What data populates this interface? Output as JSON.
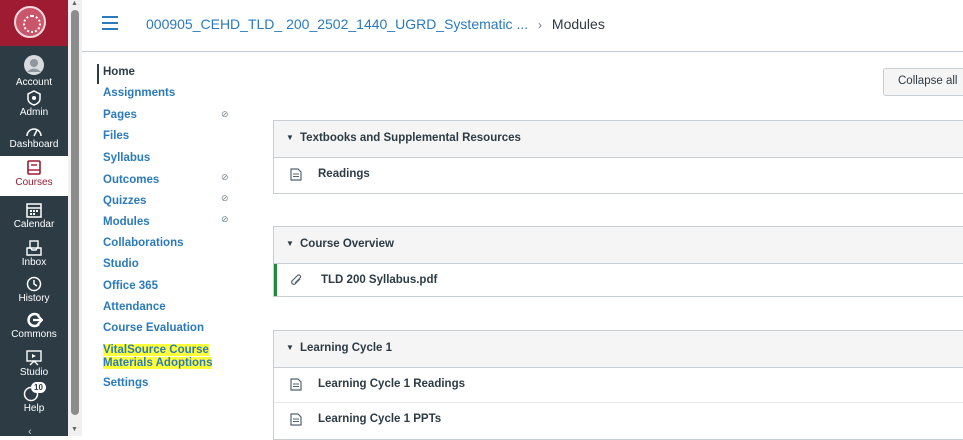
{
  "global_nav": {
    "items": [
      {
        "label": "Account",
        "icon": "account-icon"
      },
      {
        "label": "Admin",
        "icon": "admin-icon"
      },
      {
        "label": "Dashboard",
        "icon": "dashboard-icon"
      },
      {
        "label": "Courses",
        "icon": "courses-icon",
        "active": true
      },
      {
        "label": "Calendar",
        "icon": "calendar-icon"
      },
      {
        "label": "Inbox",
        "icon": "inbox-icon"
      },
      {
        "label": "History",
        "icon": "history-icon"
      },
      {
        "label": "Commons",
        "icon": "commons-icon"
      },
      {
        "label": "Studio",
        "icon": "studio-icon"
      },
      {
        "label": "Help",
        "icon": "help-icon",
        "badge": "10"
      }
    ],
    "brand_color": "#9e1b32",
    "nav_color": "#2d3b45"
  },
  "header": {
    "course_link": "000905_CEHD_TLD_ 200_2502_1440_UGRD_Systematic ...",
    "separator": "›",
    "current_page": "Modules"
  },
  "course_nav": {
    "items": [
      {
        "label": "Home",
        "current": true
      },
      {
        "label": "Assignments"
      },
      {
        "label": "Pages",
        "hidden": true
      },
      {
        "label": "Files"
      },
      {
        "label": "Syllabus"
      },
      {
        "label": "Outcomes",
        "hidden": true
      },
      {
        "label": "Quizzes",
        "hidden": true
      },
      {
        "label": "Modules",
        "hidden": true
      },
      {
        "label": "Collaborations"
      },
      {
        "label": "Studio"
      },
      {
        "label": "Office 365"
      },
      {
        "label": "Attendance"
      },
      {
        "label": "Course Evaluation"
      },
      {
        "label_line1": "VitalSource Course",
        "label_line2": "Materials Adoptions",
        "highlighted": true
      },
      {
        "label": "Settings"
      }
    ],
    "hidden_icon": "eye-slash-icon"
  },
  "toolbar": {
    "collapse_label": "Collapse all"
  },
  "modules": [
    {
      "title": "Textbooks and Supplemental Resources",
      "items": [
        {
          "label": "Readings",
          "icon": "page-icon"
        }
      ]
    },
    {
      "title": "Course Overview",
      "items": [
        {
          "label": "TLD 200 Syllabus.pdf",
          "icon": "attachment-icon"
        }
      ]
    },
    {
      "title": "Learning Cycle 1",
      "items": [
        {
          "label": "Learning Cycle 1 Readings",
          "icon": "page-icon"
        },
        {
          "label": "Learning Cycle 1 PPTs",
          "icon": "page-icon"
        }
      ]
    }
  ],
  "colors": {
    "link": "#2b7abc",
    "highlight": "#ffff3a",
    "published": "#1d8a3e"
  }
}
